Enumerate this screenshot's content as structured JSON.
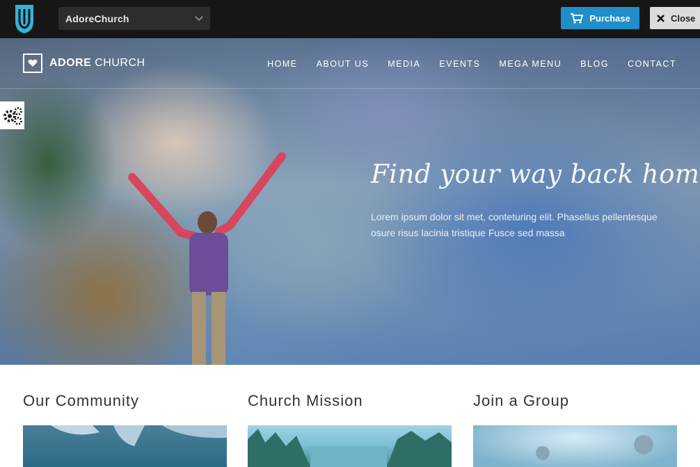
{
  "topbar": {
    "theme_name": "AdoreChurch",
    "purchase_label": "Purchase",
    "close_label": "Close",
    "accent": "#1f8ec9"
  },
  "site": {
    "brand_bold": "ADORE",
    "brand_light": "CHURCH",
    "nav": [
      "HOME",
      "ABOUT US",
      "MEDIA",
      "EVENTS",
      "MEGA MENU",
      "BLOG",
      "CONTACT"
    ]
  },
  "hero": {
    "title": "Find your way back home",
    "text": "Lorem ipsum dolor sit met, conteturing elit. Phasellus pellentesque osure risus lacinia tristique Fusce sed massa"
  },
  "columns": [
    {
      "title": "Our Community"
    },
    {
      "title": "Church Mission"
    },
    {
      "title": "Join a Group"
    }
  ],
  "icons": [
    "theme-logo-icon",
    "chevron-down-icon",
    "cart-icon",
    "close-icon",
    "heart-icon",
    "gear-icon"
  ]
}
